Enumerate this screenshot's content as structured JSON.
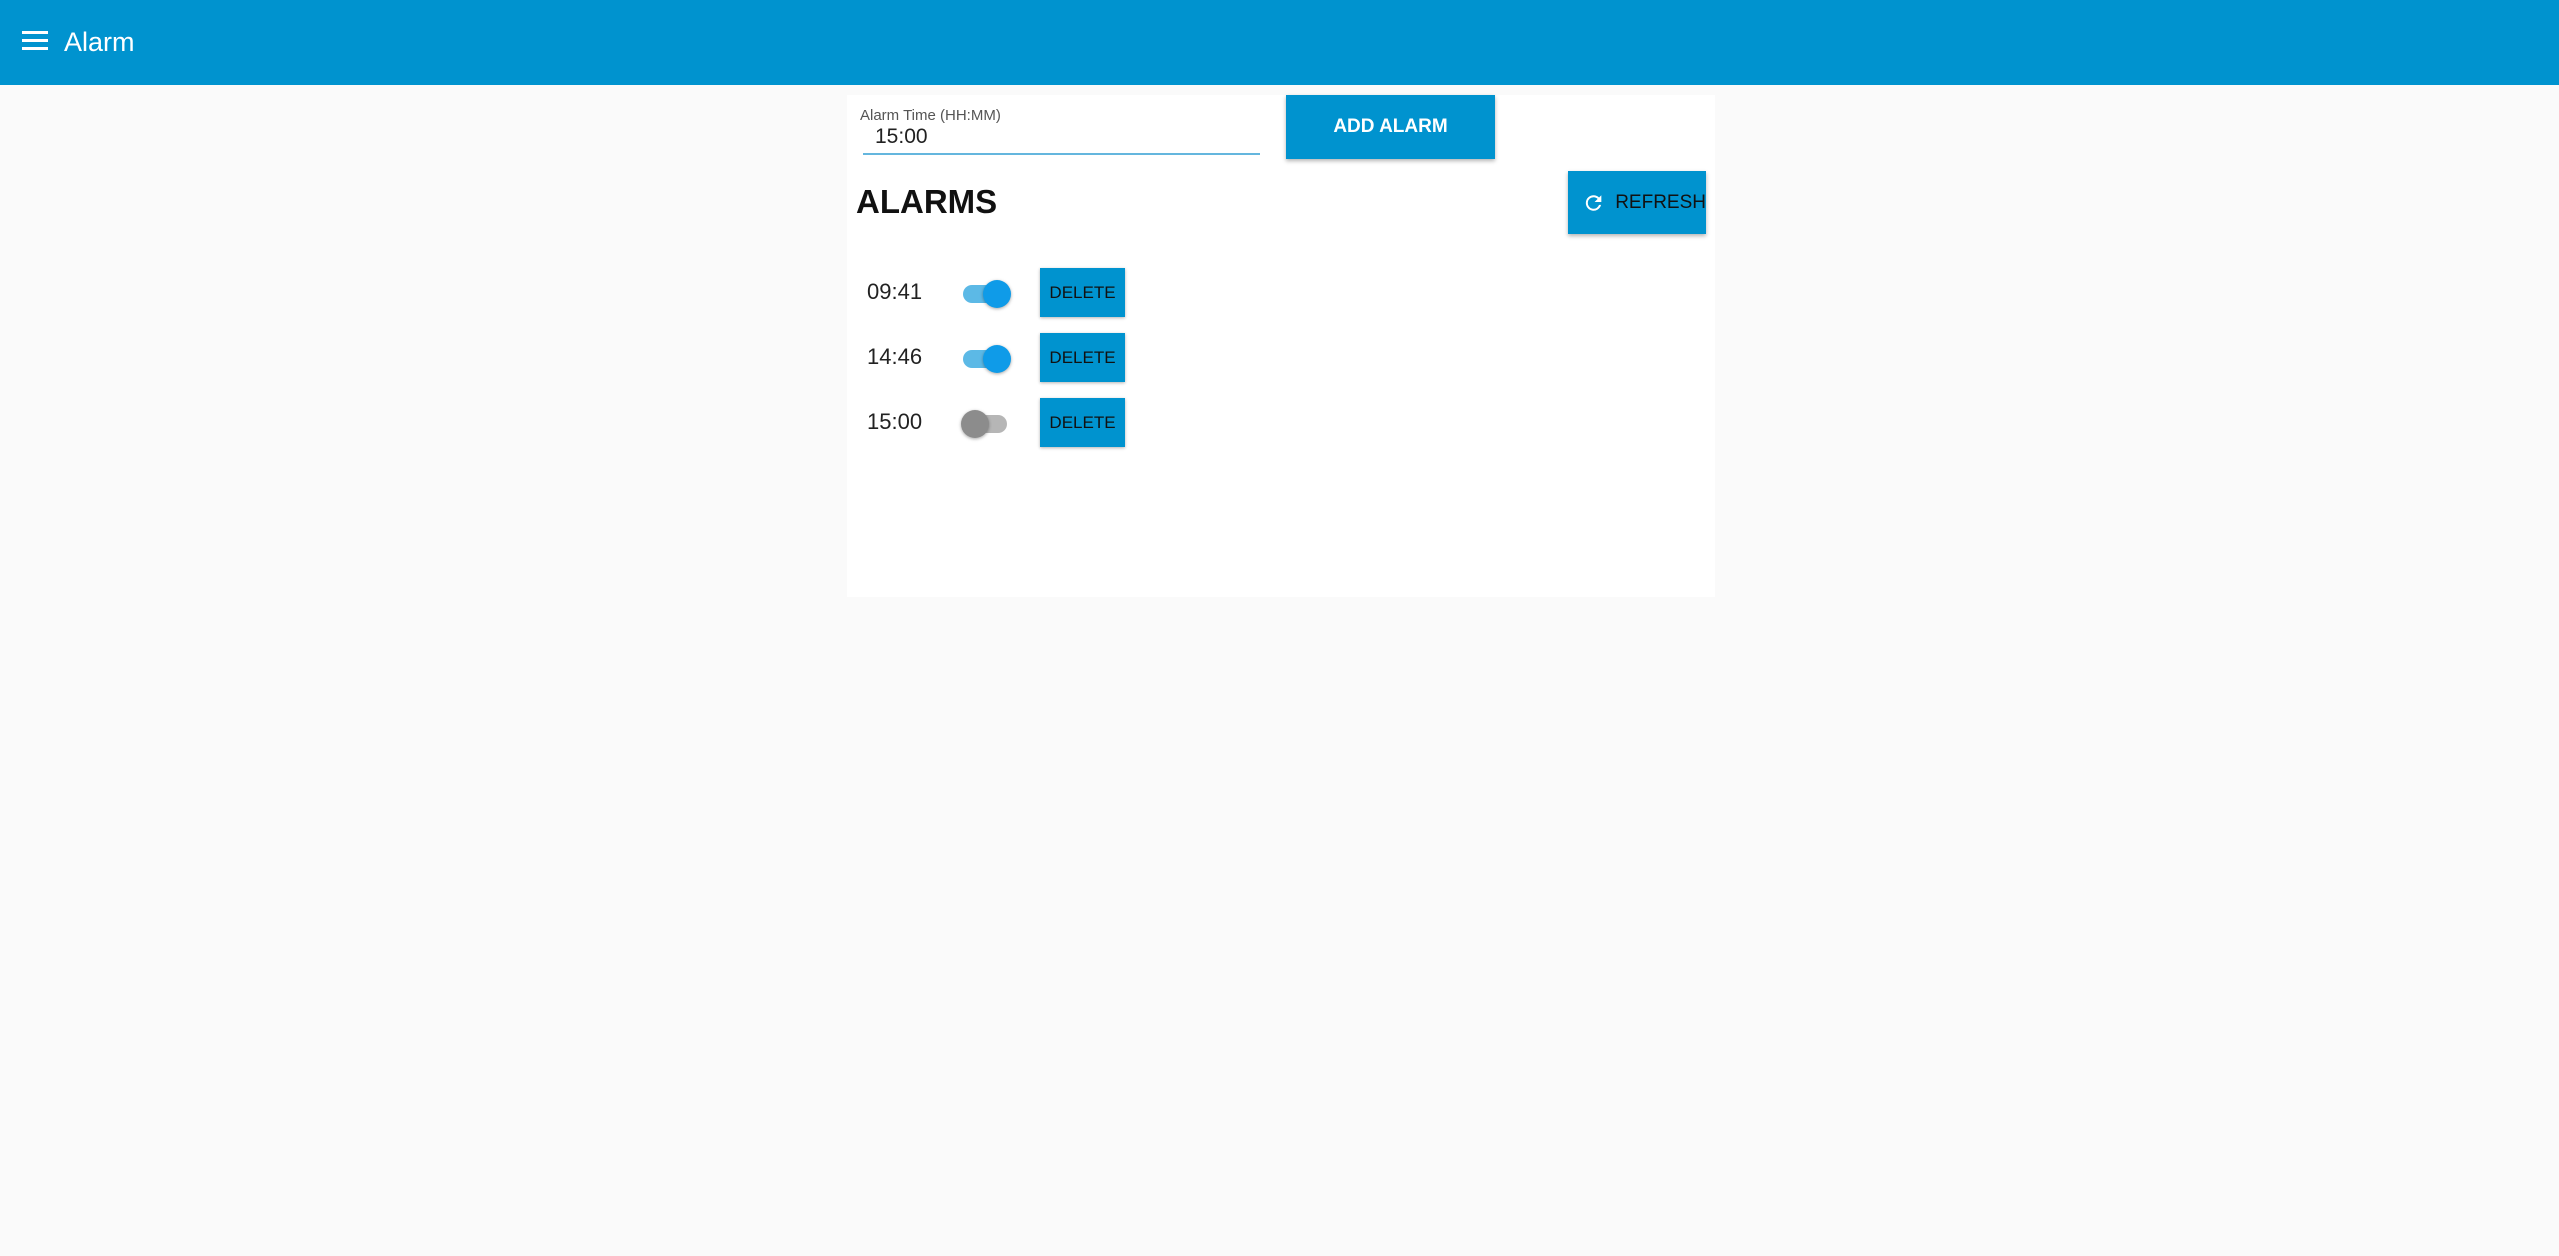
{
  "appbar": {
    "title": "Alarm",
    "menu_icon": "hamburger-menu-icon",
    "color": "#0093cf"
  },
  "form": {
    "label": "Alarm Time (HH:MM)",
    "value": "15:00",
    "add_button": "ADD ALARM"
  },
  "alarms_section": {
    "title": "ALARMS",
    "refresh_label": "REFRESH",
    "refresh_icon": "refresh-icon"
  },
  "alarms": [
    {
      "time": "09:41",
      "enabled": true,
      "delete_label": "DELETE"
    },
    {
      "time": "14:46",
      "enabled": true,
      "delete_label": "DELETE"
    },
    {
      "time": "15:00",
      "enabled": false,
      "delete_label": "DELETE"
    }
  ]
}
